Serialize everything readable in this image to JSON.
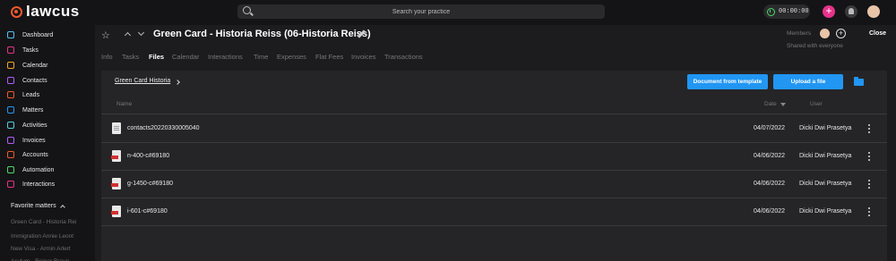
{
  "app": {
    "logo_text": "lawcus"
  },
  "topbar": {
    "search_placeholder": "Search your practice",
    "timer": "00:00:00",
    "add_label": "+"
  },
  "sidebar": {
    "items": [
      {
        "label": "Dashboard",
        "icon": "home-icon",
        "color": "#4fc3f7"
      },
      {
        "label": "Tasks",
        "icon": "check-circle-icon",
        "color": "#e6328a"
      },
      {
        "label": "Calendar",
        "icon": "calendar-icon",
        "color": "#f5a623"
      },
      {
        "label": "Contacts",
        "icon": "contacts-icon",
        "color": "#b15cff"
      },
      {
        "label": "Leads",
        "icon": "leads-icon",
        "color": "#f0592b"
      },
      {
        "label": "Matters",
        "icon": "briefcase-icon",
        "color": "#2196f3"
      },
      {
        "label": "Activities",
        "icon": "clock-icon",
        "color": "#4dd0e1"
      },
      {
        "label": "Invoices",
        "icon": "invoice-icon",
        "color": "#b15cff"
      },
      {
        "label": "Accounts",
        "icon": "bank-icon",
        "color": "#f0592b"
      },
      {
        "label": "Automation",
        "icon": "automation-icon",
        "color": "#4cd964"
      },
      {
        "label": "Interactions",
        "icon": "phone-icon",
        "color": "#e6328a"
      }
    ],
    "favorites_header": "Favorite matters",
    "favorites": [
      "Green Card - Historia Rei",
      "Immigration Annie Leont",
      "New Visa - Armin Arlert",
      "Asylum - Reiner Braun"
    ]
  },
  "matter": {
    "title": "Green Card - Historia Reiss (06-Historia Reiss)",
    "members_label": "Members",
    "shared_label": "Shared with everyone",
    "close_label": "Close"
  },
  "tabs": [
    "Info",
    "Tasks",
    "Files",
    "Calendar",
    "Interactions",
    "Time",
    "Expenses",
    "Flat Fees",
    "Invoices",
    "Transactions"
  ],
  "active_tab": "Files",
  "files": {
    "breadcrumb": "Green Card Historia",
    "template_button": "Document from template",
    "upload_button": "Upload a file",
    "columns": {
      "name": "Name",
      "date": "Date",
      "user": "User"
    },
    "rows": [
      {
        "name": "contacts20220330005040",
        "date": "04/07/2022",
        "user": "Dicki Dwi Prasetya",
        "type": "doc"
      },
      {
        "name": "n-400-c#69180",
        "date": "04/06/2022",
        "user": "Dicki Dwi Prasetya",
        "type": "pdf"
      },
      {
        "name": "g-1450-c#69180",
        "date": "04/06/2022",
        "user": "Dicki Dwi Prasetya",
        "type": "pdf"
      },
      {
        "name": "i-601-c#69180",
        "date": "04/06/2022",
        "user": "Dicki Dwi Prasetya",
        "type": "pdf"
      }
    ]
  }
}
